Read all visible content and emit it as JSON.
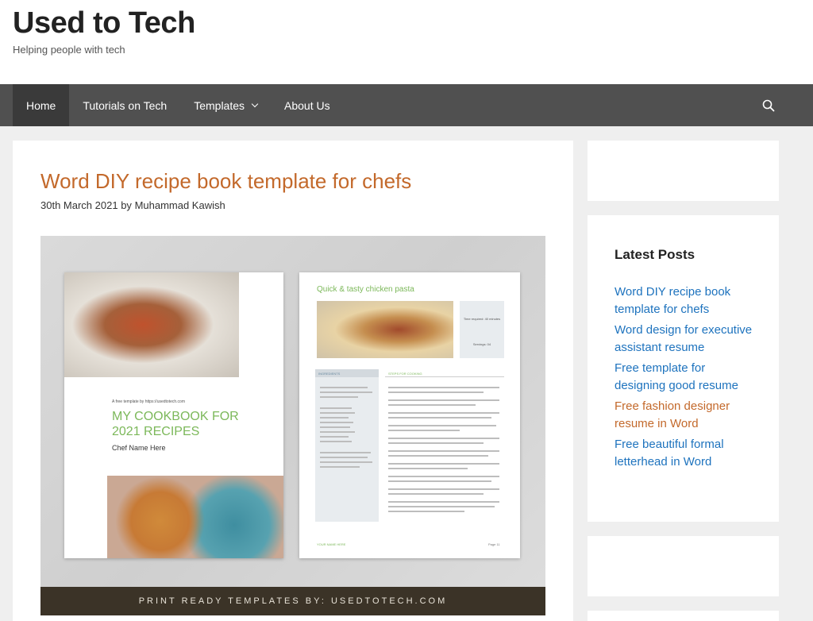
{
  "site": {
    "title": "Used to Tech",
    "tagline": "Helping people with tech"
  },
  "nav": {
    "items": [
      {
        "label": "Home",
        "active": true
      },
      {
        "label": "Tutorials on Tech"
      },
      {
        "label": "Templates",
        "has_dropdown": true
      },
      {
        "label": "About Us"
      }
    ],
    "search_icon": "search-icon"
  },
  "article": {
    "title": "Word DIY recipe book template for chefs",
    "date": "30th March 2021",
    "by": "by",
    "author": "Muhammad Kawish",
    "featured": {
      "banner": "PRINT READY TEMPLATES BY: USEDTOTECH.COM",
      "left_page": {
        "small": "A free template by https://usedtotech.com",
        "title_line1": "MY COOKBOOK FOR",
        "title_line2": "2021 RECIPES",
        "chef": "Chef Name Here"
      },
      "right_page": {
        "title": "Quick & tasty chicken pasta",
        "time": "Time required: 40 minutes",
        "servings": "Servings: 04",
        "ingredients_head": "INGREDIENTS",
        "steps_head": "STEPS FOR COOKING",
        "footer": "YOUR NAME HERE",
        "page": "Page 11"
      }
    }
  },
  "sidebar": {
    "latest_title": "Latest Posts",
    "posts": [
      {
        "label": "Word DIY recipe book template for chefs",
        "visited": false
      },
      {
        "label": "Word design for executive assistant resume",
        "visited": false
      },
      {
        "label": "Free template for designing good resume",
        "visited": false
      },
      {
        "label": "Free fashion designer resume in Word",
        "visited": true
      },
      {
        "label": "Free beautiful formal letterhead in Word",
        "visited": false
      }
    ]
  },
  "colors": {
    "accent": "#c3692b",
    "link": "#1e73be",
    "nav_bg": "#505050",
    "nav_active": "#3a3a3a"
  }
}
